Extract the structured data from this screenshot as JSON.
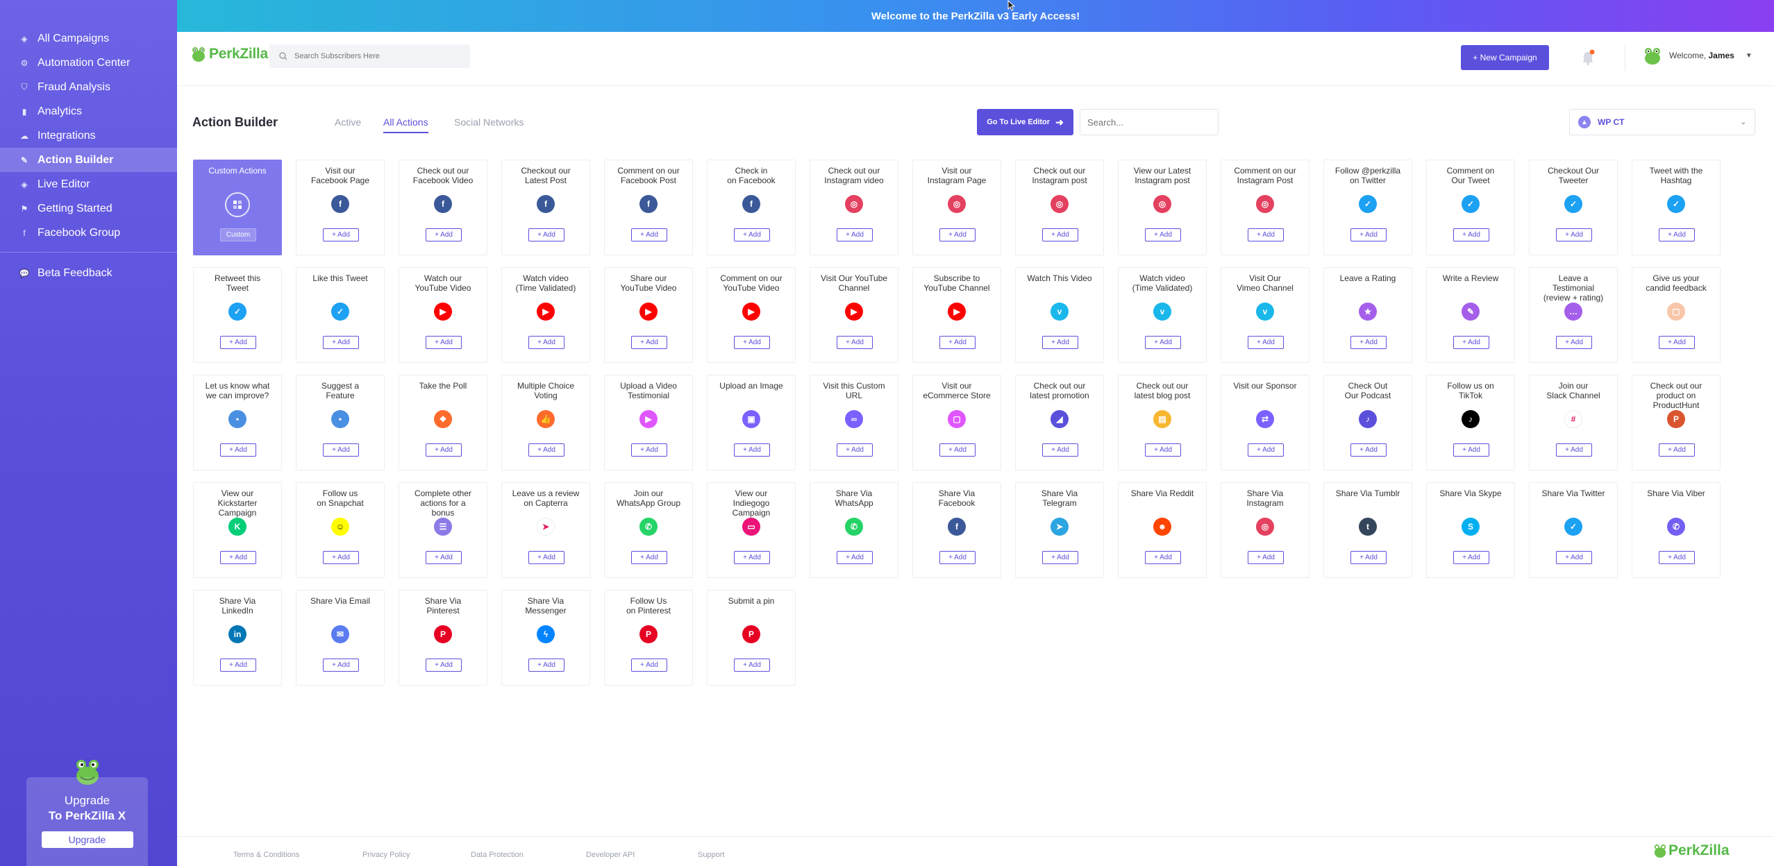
{
  "banner": {
    "text": "Welcome to the PerkZilla v3 Early Access!"
  },
  "sidebar": {
    "items": [
      {
        "label": "All Campaigns",
        "icon": "layers-icon",
        "active": false
      },
      {
        "label": "Automation Center",
        "icon": "gear-icon",
        "active": false
      },
      {
        "label": "Fraud Analysis",
        "icon": "shield-icon",
        "active": false
      },
      {
        "label": "Analytics",
        "icon": "bar-chart-icon",
        "active": false
      },
      {
        "label": "Integrations",
        "icon": "cloud-icon",
        "active": false
      },
      {
        "label": "Action Builder",
        "icon": "brush-icon",
        "active": true
      },
      {
        "label": "Live Editor",
        "icon": "layers-icon",
        "active": false
      },
      {
        "label": "Getting Started",
        "icon": "run-icon",
        "active": false
      },
      {
        "label": "Facebook Group",
        "icon": "facebook-icon",
        "active": false
      }
    ],
    "beta_feedback": "Beta Feedback",
    "upgrade": {
      "line1": "Upgrade",
      "line2": "To PerkZilla X",
      "button": "Upgrade"
    }
  },
  "header": {
    "logo_text": "PerkZilla",
    "search_placeholder": "Search Subscribers Here",
    "new_campaign": "+ New Campaign",
    "welcome": "Welcome,",
    "user_name": "James"
  },
  "toolbar": {
    "title": "Action Builder",
    "tabs": [
      {
        "label": "Active",
        "active": false
      },
      {
        "label": "All Actions",
        "active": true
      },
      {
        "label": "Social Networks",
        "active": false
      }
    ],
    "live_editor": "Go To Live Editor",
    "search_placeholder": "Search...",
    "campaign_select": "WP CT"
  },
  "custom_card": {
    "title": "Custom Actions",
    "button": "Custom"
  },
  "add_label": "+ Add",
  "actions": [
    {
      "title": "Visit our\nFacebook Page",
      "icon": "facebook-icon",
      "color": "#3b5998",
      "glyph": "f"
    },
    {
      "title": "Check out our\nFacebook Video",
      "icon": "facebook-icon",
      "color": "#3b5998",
      "glyph": "f"
    },
    {
      "title": "Checkout our\nLatest Post",
      "icon": "facebook-icon",
      "color": "#3b5998",
      "glyph": "f"
    },
    {
      "title": "Comment on our\nFacebook Post",
      "icon": "facebook-icon",
      "color": "#3b5998",
      "glyph": "f"
    },
    {
      "title": "Check in\non Facebook",
      "icon": "facebook-icon",
      "color": "#3b5998",
      "glyph": "f"
    },
    {
      "title": "Check out our\nInstagram video",
      "icon": "instagram-icon",
      "color": "#e4405f",
      "glyph": "◎"
    },
    {
      "title": "Visit our\nInstagram Page",
      "icon": "instagram-icon",
      "color": "#e4405f",
      "glyph": "◎"
    },
    {
      "title": "Check out our\nInstagram post",
      "icon": "instagram-icon",
      "color": "#e4405f",
      "glyph": "◎"
    },
    {
      "title": "View our Latest\nInstagram post",
      "icon": "instagram-icon",
      "color": "#e4405f",
      "glyph": "◎"
    },
    {
      "title": "Comment on our\nInstagram Post",
      "icon": "instagram-icon",
      "color": "#e4405f",
      "glyph": "◎"
    },
    {
      "title": "Follow @perkzilla\non Twitter",
      "icon": "twitter-icon",
      "color": "#1da1f2",
      "glyph": "✓"
    },
    {
      "title": "Comment on\nOur Tweet",
      "icon": "twitter-icon",
      "color": "#1da1f2",
      "glyph": "✓"
    },
    {
      "title": "Checkout Our\nTweeter",
      "icon": "twitter-icon",
      "color": "#1da1f2",
      "glyph": "✓"
    },
    {
      "title": "Tweet with the\nHashtag",
      "icon": "twitter-icon",
      "color": "#1da1f2",
      "glyph": "✓"
    },
    {
      "title": "Retweet this\nTweet",
      "icon": "twitter-icon",
      "color": "#1da1f2",
      "glyph": "✓"
    },
    {
      "title": "Like this Tweet",
      "icon": "twitter-icon",
      "color": "#1da1f2",
      "glyph": "✓"
    },
    {
      "title": "Watch our\nYouTube Video",
      "icon": "youtube-icon",
      "color": "#ff0000",
      "glyph": "▶"
    },
    {
      "title": "Watch video\n(Time Validated)",
      "icon": "youtube-icon",
      "color": "#ff0000",
      "glyph": "▶"
    },
    {
      "title": "Share our\nYouTube Video",
      "icon": "youtube-icon",
      "color": "#ff0000",
      "glyph": "▶"
    },
    {
      "title": "Comment on our\nYouTube Video",
      "icon": "youtube-icon",
      "color": "#ff0000",
      "glyph": "▶"
    },
    {
      "title": "Visit Our YouTube\nChannel",
      "icon": "youtube-icon",
      "color": "#ff0000",
      "glyph": "▶"
    },
    {
      "title": "Subscribe to\nYouTube Channel",
      "icon": "youtube-icon",
      "color": "#ff0000",
      "glyph": "▶"
    },
    {
      "title": "Watch This Video",
      "icon": "vimeo-icon",
      "color": "#1ab7ea",
      "glyph": "v"
    },
    {
      "title": "Watch video\n(Time Validated)",
      "icon": "vimeo-icon",
      "color": "#1ab7ea",
      "glyph": "v"
    },
    {
      "title": "Visit Our\nVimeo Channel",
      "icon": "vimeo-icon",
      "color": "#1ab7ea",
      "glyph": "v"
    },
    {
      "title": "Leave a Rating",
      "icon": "star-icon",
      "color": "#a55eea",
      "glyph": "★"
    },
    {
      "title": "Write a Review",
      "icon": "review-icon",
      "color": "#a55eea",
      "glyph": "✎"
    },
    {
      "title": "Leave a\nTestimonial\n(review + rating)",
      "icon": "chat-icon",
      "color": "#a55eea",
      "glyph": "…"
    },
    {
      "title": "Give us your\ncandid feedback",
      "icon": "feedback-icon",
      "color": "#f7c6a8",
      "glyph": "▢"
    },
    {
      "title": "Let us know what\nwe can improve?",
      "icon": "comment-icon",
      "color": "#4a90e2",
      "glyph": "•"
    },
    {
      "title": "Suggest a\nFeature",
      "icon": "comment-icon",
      "color": "#4a90e2",
      "glyph": "•"
    },
    {
      "title": "Take the Poll",
      "icon": "poll-icon",
      "color": "#ff6b2c",
      "glyph": "❖"
    },
    {
      "title": "Multiple Choice\nVoting",
      "icon": "thumbs-up-icon",
      "color": "#ff6b2c",
      "glyph": "👍"
    },
    {
      "title": "Upload a Video\nTestimonial",
      "icon": "video-icon",
      "color": "#e056fd",
      "glyph": "▶"
    },
    {
      "title": "Upload an Image",
      "icon": "image-icon",
      "color": "#7b61ff",
      "glyph": "▣"
    },
    {
      "title": "Visit this Custom\nURL",
      "icon": "link-icon",
      "color": "#7b61ff",
      "glyph": "∞"
    },
    {
      "title": "Visit our\neCommerce Store",
      "icon": "store-icon",
      "color": "#e056fd",
      "glyph": "▢"
    },
    {
      "title": "Check out our\nlatest promotion",
      "icon": "megaphone-icon",
      "color": "#5b50dc",
      "glyph": "◢"
    },
    {
      "title": "Check out our\nlatest blog post",
      "icon": "blog-icon",
      "color": "#f7b731",
      "glyph": "▤"
    },
    {
      "title": "Visit our Sponsor",
      "icon": "sponsor-icon",
      "color": "#7b61ff",
      "glyph": "⇄"
    },
    {
      "title": "Check Out\nOur Podcast",
      "icon": "microphone-icon",
      "color": "#5b50dc",
      "glyph": "♪"
    },
    {
      "title": "Follow us on\nTikTok",
      "icon": "tiktok-icon",
      "color": "#000000",
      "glyph": "♪"
    },
    {
      "title": "Join our\nSlack Channel",
      "icon": "slack-icon",
      "color": "#ffffff",
      "glyph": "#"
    },
    {
      "title": "Check out our\nproduct on\nProductHunt",
      "icon": "producthunt-icon",
      "color": "#da552f",
      "glyph": "P"
    },
    {
      "title": "View our\nKickstarter\nCampaign",
      "icon": "kickstarter-icon",
      "color": "#05ce78",
      "glyph": "K"
    },
    {
      "title": "Follow us\non Snapchat",
      "icon": "snapchat-icon",
      "color": "#fffc00",
      "glyph": "☺"
    },
    {
      "title": "Complete other\nactions for a\nbonus",
      "icon": "checklist-icon",
      "color": "#8c7ae6",
      "glyph": "☰"
    },
    {
      "title": "Leave us a review\non Capterra",
      "icon": "capterra-icon",
      "color": "#ffffff",
      "glyph": "➤"
    },
    {
      "title": "Join our\nWhatsApp Group",
      "icon": "whatsapp-icon",
      "color": "#25d366",
      "glyph": "✆"
    },
    {
      "title": "View our\nIndiegogo\nCampaign",
      "icon": "indiegogo-icon",
      "color": "#eb1478",
      "glyph": "▭"
    },
    {
      "title": "Share Via\nWhatsApp",
      "icon": "whatsapp-icon",
      "color": "#25d366",
      "glyph": "✆"
    },
    {
      "title": "Share Via\nFacebook",
      "icon": "facebook-icon",
      "color": "#3b5998",
      "glyph": "f"
    },
    {
      "title": "Share Via\nTelegram",
      "icon": "telegram-icon",
      "color": "#2ca5e0",
      "glyph": "➤"
    },
    {
      "title": "Share Via Reddit",
      "icon": "reddit-icon",
      "color": "#ff4500",
      "glyph": "☻"
    },
    {
      "title": "Share Via\nInstagram",
      "icon": "instagram-icon",
      "color": "#e4405f",
      "glyph": "◎"
    },
    {
      "title": "Share Via Tumblr",
      "icon": "tumblr-icon",
      "color": "#35465c",
      "glyph": "t"
    },
    {
      "title": "Share Via Skype",
      "icon": "skype-icon",
      "color": "#00aff0",
      "glyph": "S"
    },
    {
      "title": "Share Via Twitter",
      "icon": "twitter-icon",
      "color": "#1da1f2",
      "glyph": "✓"
    },
    {
      "title": "Share Via Viber",
      "icon": "viber-icon",
      "color": "#7360f2",
      "glyph": "✆"
    },
    {
      "title": "Share Via\nLinkedIn",
      "icon": "linkedin-icon",
      "color": "#0077b5",
      "glyph": "in"
    },
    {
      "title": "Share Via Email",
      "icon": "email-icon",
      "color": "#5b7cf0",
      "glyph": "✉"
    },
    {
      "title": "Share Via\nPinterest",
      "icon": "pinterest-icon",
      "color": "#e60023",
      "glyph": "P"
    },
    {
      "title": "Share Via\nMessenger",
      "icon": "messenger-icon",
      "color": "#0084ff",
      "glyph": "ϟ"
    },
    {
      "title": "Follow Us\non Pinterest",
      "icon": "pinterest-icon",
      "color": "#e60023",
      "glyph": "P"
    },
    {
      "title": "Submit a pin",
      "icon": "pinterest-icon",
      "color": "#e60023",
      "glyph": "P"
    }
  ],
  "footer": {
    "links": [
      "Terms & Conditions",
      "Privacy Policy",
      "Data Protection",
      "Developer API",
      "Support"
    ],
    "logo_text": "PerkZilla"
  },
  "colors": {
    "accent": "#5b50dc",
    "brand_green": "#55b947"
  }
}
